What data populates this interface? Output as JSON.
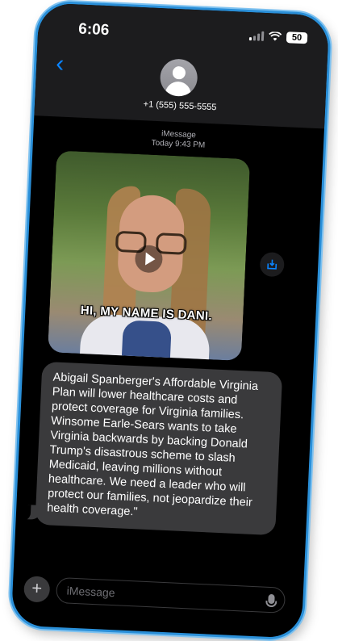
{
  "status_bar": {
    "time": "6:06",
    "battery": "50"
  },
  "header": {
    "contact_number": "+1 (555) 555-5555"
  },
  "thread": {
    "service": "iMessage",
    "timestamp": "Today 9:43 PM"
  },
  "video": {
    "caption": "HI, MY NAME IS DANI."
  },
  "message": {
    "text": "Abigail Spanberger's Affordable Virginia Plan will lower healthcare costs and protect coverage for Virginia families. Winsome Earle-Sears wants to take Virginia backwards by backing Donald Trump's disastrous scheme to slash Medicaid, leaving millions without healthcare. We need a leader who will protect our families, not jeopardize their health coverage.\""
  },
  "composer": {
    "placeholder": "iMessage"
  },
  "colors": {
    "accent": "#0a84ff",
    "frame": "#2a8fd8",
    "bubble": "#3a3a3c"
  }
}
